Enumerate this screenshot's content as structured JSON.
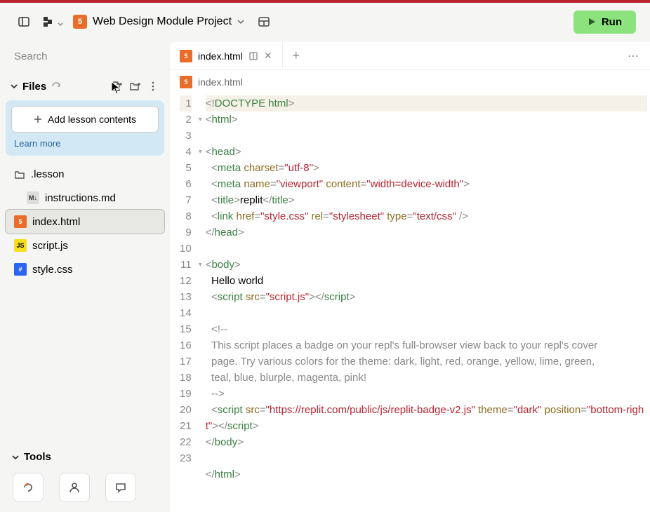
{
  "header": {
    "project_name": "Web Design Module Project",
    "run_label": "Run"
  },
  "sidebar": {
    "search_placeholder": "Search",
    "files_label": "Files",
    "lesson_button": "Add lesson contents",
    "learn_more": "Learn more",
    "tools_label": "Tools",
    "tree": [
      {
        "name": ".lesson",
        "type": "folder"
      },
      {
        "name": "instructions.md",
        "type": "md",
        "indent": true
      },
      {
        "name": "index.html",
        "type": "html",
        "sel": true,
        "cursel": true
      },
      {
        "name": "script.js",
        "type": "js"
      },
      {
        "name": "style.css",
        "type": "css"
      }
    ]
  },
  "tabs": {
    "active": "index.html",
    "breadcrumb": "index.html"
  },
  "code": {
    "lines": [
      {
        "n": 1,
        "t": [
          [
            "pn",
            "<!"
          ],
          [
            "tg",
            "DOCTYPE html"
          ],
          [
            "pn",
            ">"
          ]
        ],
        "hl": true
      },
      {
        "n": 2,
        "f": true,
        "t": [
          [
            "pn",
            "<"
          ],
          [
            "tg",
            "html"
          ],
          [
            "pn",
            ">"
          ]
        ]
      },
      {
        "n": 3,
        "t": []
      },
      {
        "n": 4,
        "f": true,
        "t": [
          [
            "pn",
            "<"
          ],
          [
            "tg",
            "head"
          ],
          [
            "pn",
            ">"
          ]
        ]
      },
      {
        "n": 5,
        "t": [
          [
            "",
            "  "
          ],
          [
            "pn",
            "<"
          ],
          [
            "tg",
            "meta"
          ],
          [
            "",
            " "
          ],
          [
            "at",
            "charset"
          ],
          [
            "pn",
            "="
          ],
          [
            "st",
            "\"utf-8\""
          ],
          [
            "pn",
            ">"
          ]
        ]
      },
      {
        "n": 6,
        "t": [
          [
            "",
            "  "
          ],
          [
            "pn",
            "<"
          ],
          [
            "tg",
            "meta"
          ],
          [
            "",
            " "
          ],
          [
            "at",
            "name"
          ],
          [
            "pn",
            "="
          ],
          [
            "st",
            "\"viewport\""
          ],
          [
            "",
            " "
          ],
          [
            "at",
            "content"
          ],
          [
            "pn",
            "="
          ],
          [
            "st",
            "\"width=device-width\""
          ],
          [
            "pn",
            ">"
          ]
        ]
      },
      {
        "n": 7,
        "t": [
          [
            "",
            "  "
          ],
          [
            "pn",
            "<"
          ],
          [
            "tg",
            "title"
          ],
          [
            "pn",
            ">"
          ],
          [
            "",
            "replit"
          ],
          [
            "pn",
            "</"
          ],
          [
            "tg",
            "title"
          ],
          [
            "pn",
            ">"
          ]
        ]
      },
      {
        "n": 8,
        "t": [
          [
            "",
            "  "
          ],
          [
            "pn",
            "<"
          ],
          [
            "tg",
            "link"
          ],
          [
            "",
            " "
          ],
          [
            "at",
            "href"
          ],
          [
            "pn",
            "="
          ],
          [
            "st",
            "\"style.css\""
          ],
          [
            "",
            " "
          ],
          [
            "at",
            "rel"
          ],
          [
            "pn",
            "="
          ],
          [
            "st",
            "\"stylesheet\""
          ],
          [
            "",
            " "
          ],
          [
            "at",
            "type"
          ],
          [
            "pn",
            "="
          ],
          [
            "st",
            "\"text/css\""
          ],
          [
            "",
            " "
          ],
          [
            "pn",
            "/>"
          ]
        ]
      },
      {
        "n": 9,
        "t": [
          [
            "pn",
            "</"
          ],
          [
            "tg",
            "head"
          ],
          [
            "pn",
            ">"
          ]
        ]
      },
      {
        "n": 10,
        "t": []
      },
      {
        "n": 11,
        "f": true,
        "t": [
          [
            "pn",
            "<"
          ],
          [
            "tg",
            "body"
          ],
          [
            "pn",
            ">"
          ]
        ]
      },
      {
        "n": 12,
        "t": [
          [
            "",
            "  Hello world"
          ]
        ]
      },
      {
        "n": 13,
        "t": [
          [
            "",
            "  "
          ],
          [
            "pn",
            "<"
          ],
          [
            "tg",
            "script"
          ],
          [
            "",
            " "
          ],
          [
            "at",
            "src"
          ],
          [
            "pn",
            "="
          ],
          [
            "st",
            "\"script.js\""
          ],
          [
            "pn",
            "></"
          ],
          [
            "tg",
            "script"
          ],
          [
            "pn",
            ">"
          ]
        ]
      },
      {
        "n": 14,
        "t": []
      },
      {
        "n": 15,
        "t": [
          [
            "",
            "  "
          ],
          [
            "cm",
            "<!--"
          ]
        ]
      },
      {
        "n": 16,
        "t": [
          [
            "cm",
            "  This script places a badge on your repl's full-browser view back to your repl's cover"
          ]
        ]
      },
      {
        "n": 17,
        "t": [
          [
            "cm",
            "  page. Try various colors for the theme: dark, light, red, orange, yellow, lime, green,"
          ]
        ]
      },
      {
        "n": 18,
        "t": [
          [
            "cm",
            "  teal, blue, blurple, magenta, pink!"
          ]
        ]
      },
      {
        "n": 19,
        "t": [
          [
            "cm",
            "  -->"
          ]
        ]
      },
      {
        "n": 20,
        "t": [
          [
            "",
            "  "
          ],
          [
            "pn",
            "<"
          ],
          [
            "tg",
            "script"
          ],
          [
            "",
            " "
          ],
          [
            "at",
            "src"
          ],
          [
            "pn",
            "="
          ],
          [
            "st",
            "\"https://replit.com/public/js/replit-badge-v2.js\""
          ],
          [
            "",
            " "
          ],
          [
            "at",
            "theme"
          ],
          [
            "pn",
            "="
          ],
          [
            "st",
            "\"dark\""
          ],
          [
            "",
            " "
          ],
          [
            "at",
            "position"
          ],
          [
            "pn",
            "="
          ],
          [
            "st",
            "\"bottom-right\""
          ],
          [
            "pn",
            "></"
          ],
          [
            "tg",
            "script"
          ],
          [
            "pn",
            ">"
          ]
        ]
      },
      {
        "n": 21,
        "t": [
          [
            "pn",
            "</"
          ],
          [
            "tg",
            "body"
          ],
          [
            "pn",
            ">"
          ]
        ]
      },
      {
        "n": 22,
        "t": []
      },
      {
        "n": 23,
        "t": [
          [
            "pn",
            "</"
          ],
          [
            "tg",
            "html"
          ],
          [
            "pn",
            ">"
          ]
        ]
      }
    ]
  }
}
